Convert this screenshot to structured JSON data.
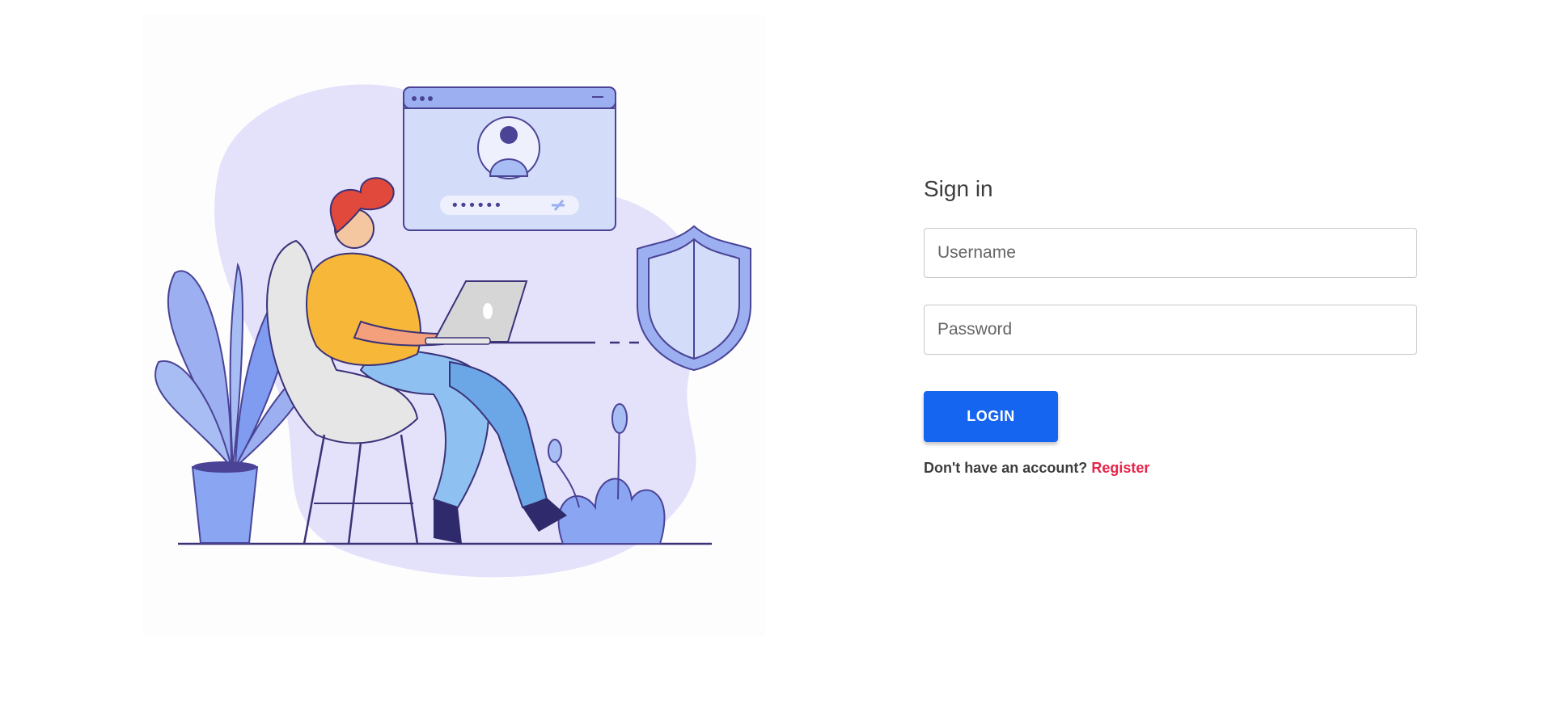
{
  "illustration": {
    "password_mask": "••••••"
  },
  "form": {
    "title": "Sign in",
    "username_placeholder": "Username",
    "password_placeholder": "Password",
    "login_label": "LOGIN",
    "no_account_text": "Don't have an account?",
    "register_label": "Register"
  },
  "colors": {
    "primary": "#1665f0",
    "link": "#e8244a",
    "text": "#3d3d3d"
  }
}
